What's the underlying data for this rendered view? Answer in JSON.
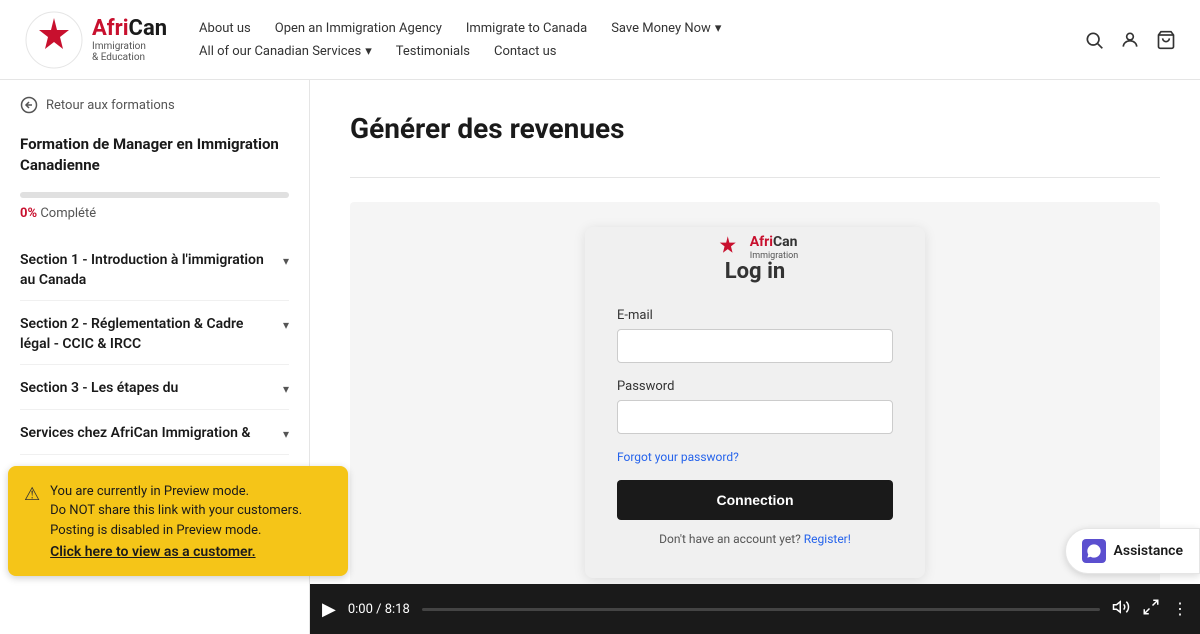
{
  "header": {
    "logo": {
      "brand": "AfriCan",
      "brand_prefix": "Afri",
      "brand_suffix": "Can",
      "subtitle1": "Immigration",
      "subtitle2": "& Education"
    },
    "nav_row1": [
      {
        "label": "About us",
        "dropdown": false
      },
      {
        "label": "Open an Immigration Agency",
        "dropdown": false
      },
      {
        "label": "Immigrate to Canada",
        "dropdown": false
      },
      {
        "label": "Save Money Now",
        "dropdown": true
      }
    ],
    "nav_row2": [
      {
        "label": "All of our Canadian Services",
        "dropdown": true
      },
      {
        "label": "Testimonials",
        "dropdown": false
      },
      {
        "label": "Contact us",
        "dropdown": false
      }
    ]
  },
  "sidebar": {
    "back_label": "Retour aux formations",
    "course_title": "Formation de Manager en Immigration Canadienne",
    "progress_pct": "0%",
    "progress_label": "Complété",
    "sections": [
      {
        "title": "Section 1 - Introduction à l'immigration au Canada",
        "expanded": false
      },
      {
        "title": "Section 2 - Réglementation & Cadre légal - CCIC & IRCC",
        "expanded": false
      },
      {
        "title": "Section 3 - Les étapes du",
        "expanded": false
      },
      {
        "title": "Services chez AfriCan Immigration &",
        "expanded": false
      }
    ]
  },
  "main": {
    "page_title": "Générer des revenues",
    "login_card": {
      "title": "Log in",
      "email_label": "E-mail",
      "email_placeholder": "",
      "password_label": "Password",
      "password_placeholder": "",
      "forgot_label": "Forgot your password?",
      "button_label": "Connection",
      "register_text": "Don't have an account yet?",
      "register_link": "Register!"
    }
  },
  "video_bar": {
    "time": "0:00 / 8:18"
  },
  "preview_banner": {
    "line1": "You are currently in Preview mode.",
    "line2": "Do NOT share this link with your customers.",
    "line3": "Posting is disabled in Preview mode.",
    "link_label": "Click here to view as a customer."
  },
  "assistance": {
    "label": "Assistance"
  }
}
